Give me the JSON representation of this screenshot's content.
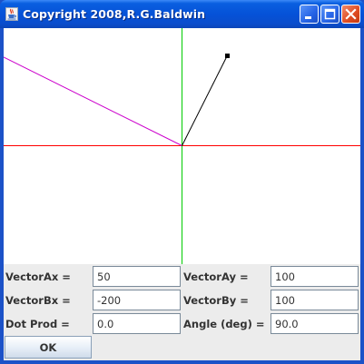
{
  "window": {
    "title": "Copyright 2008,R.G.Baldwin",
    "icon": "java-cup-icon",
    "controls": [
      "minimize-icon",
      "maximize-icon",
      "close-icon"
    ]
  },
  "colors": {
    "title_bar": "#0552d8",
    "x_axis": "#ff0000",
    "y_axis": "#00cc00",
    "vector_a": "#000000",
    "vector_b": "#cc00cc",
    "panel_bg": "#ececec"
  },
  "form": {
    "vector_ax_label": "VectorAx =",
    "vector_ax_value": "50",
    "vector_ay_label": "VectorAy =",
    "vector_ay_value": "100",
    "vector_bx_label": "VectorBx =",
    "vector_bx_value": "-200",
    "vector_by_label": "VectorBy =",
    "vector_by_value": "100",
    "dot_prod_label": "Dot Prod =",
    "dot_prod_value": "0.0",
    "angle_label": "Angle (deg) =",
    "angle_value": "90.0"
  },
  "ok_label": "OK"
}
